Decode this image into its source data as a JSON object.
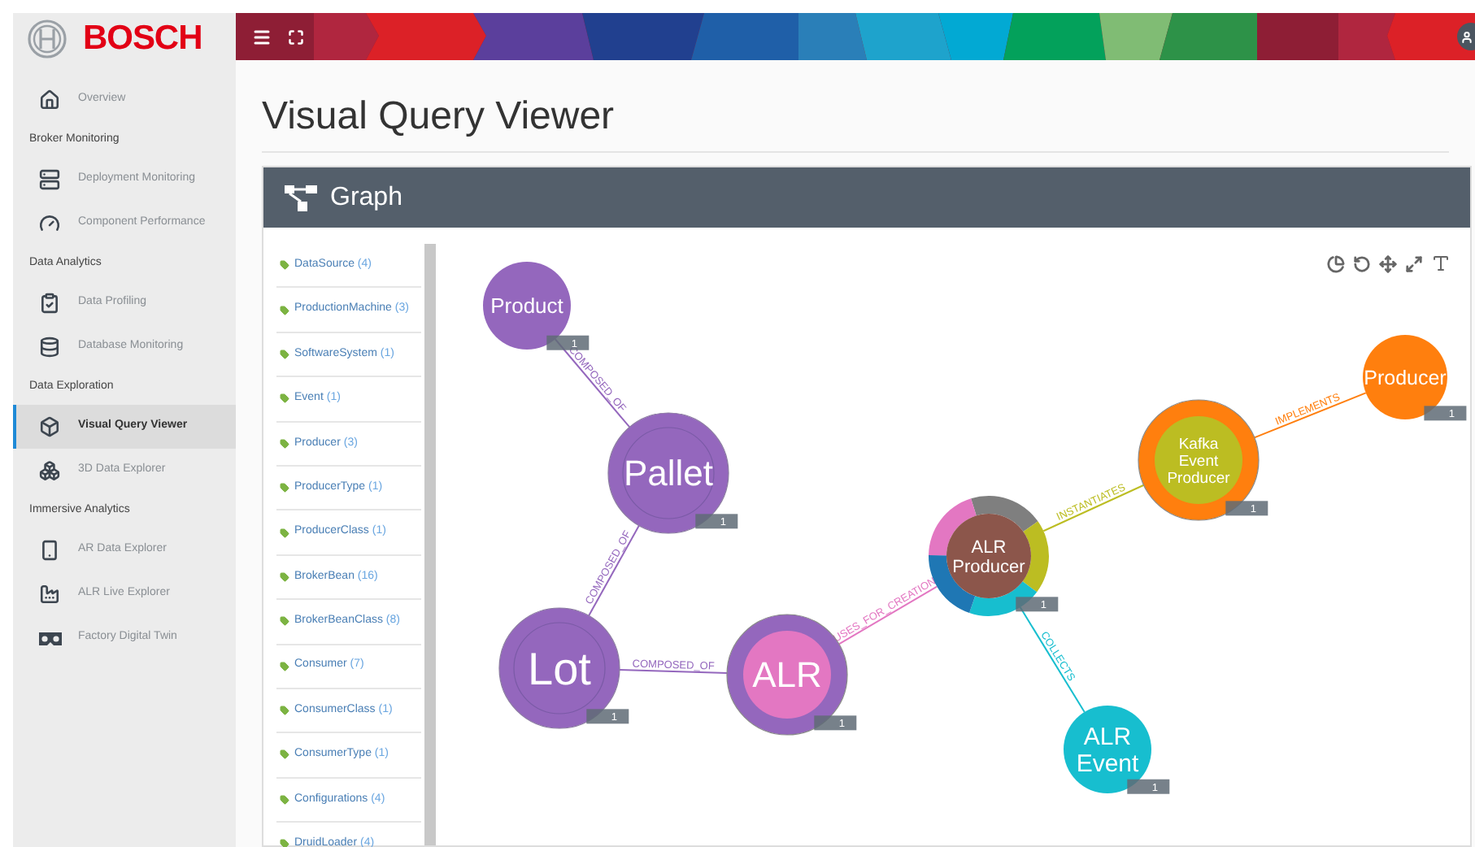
{
  "brand": {
    "name": "BOSCH"
  },
  "sidebar": {
    "items": [
      {
        "kind": "link",
        "label": "Overview",
        "selected": false
      },
      {
        "kind": "heading",
        "label": "Broker Monitoring"
      },
      {
        "kind": "link",
        "label": "Deployment Monitoring",
        "selected": false
      },
      {
        "kind": "link",
        "label": "Component Performance",
        "selected": false
      },
      {
        "kind": "heading",
        "label": "Data Analytics"
      },
      {
        "kind": "link",
        "label": "Data Profiling",
        "selected": false
      },
      {
        "kind": "link",
        "label": "Database Monitoring",
        "selected": false
      },
      {
        "kind": "heading",
        "label": "Data Exploration"
      },
      {
        "kind": "link",
        "label": "Visual Query Viewer",
        "selected": true
      },
      {
        "kind": "link",
        "label": "3D Data Explorer",
        "selected": false
      },
      {
        "kind": "heading",
        "label": "Immersive Analytics"
      },
      {
        "kind": "link",
        "label": "AR Data Explorer",
        "selected": false
      },
      {
        "kind": "link",
        "label": "ALR Live Explorer",
        "selected": false
      },
      {
        "kind": "link",
        "label": "Factory Digital Twin",
        "selected": false
      }
    ]
  },
  "page": {
    "title": "Visual Query Viewer"
  },
  "panel": {
    "title": "Graph"
  },
  "classes": [
    {
      "name": "DataSource",
      "count": "(4)"
    },
    {
      "name": "ProductionMachine",
      "count": "(3)"
    },
    {
      "name": "SoftwareSystem",
      "count": "(1)"
    },
    {
      "name": "Event",
      "count": "(1)"
    },
    {
      "name": "Producer",
      "count": "(3)"
    },
    {
      "name": "ProducerType",
      "count": "(1)"
    },
    {
      "name": "ProducerClass",
      "count": "(1)"
    },
    {
      "name": "BrokerBean",
      "count": "(16)"
    },
    {
      "name": "BrokerBeanClass",
      "count": "(8)"
    },
    {
      "name": "Consumer",
      "count": "(7)"
    },
    {
      "name": "ConsumerClass",
      "count": "(1)"
    },
    {
      "name": "ConsumerType",
      "count": "(1)"
    },
    {
      "name": "Configurations",
      "count": "(4)"
    },
    {
      "name": "DruidLoader",
      "count": "(4)"
    }
  ],
  "graph": {
    "nodes": [
      {
        "kind": "plain",
        "label": "Product",
        "color": "#9467bd",
        "count": "1"
      },
      {
        "kind": "ringed",
        "label": "Pallet",
        "color": "#9467bd",
        "count": "1"
      },
      {
        "kind": "ringed",
        "label": "Lot",
        "color": "#9467bd",
        "count": "1"
      },
      {
        "kind": "inner",
        "label": "ALR",
        "color": "#9467bd",
        "count": "1"
      },
      {
        "kind": "donut",
        "label": "ALR Producer",
        "color": "#8c564b",
        "count": "1"
      },
      {
        "kind": "inner",
        "label": "Kafka Event Producer",
        "color": "#ff7f0e",
        "count": "1"
      },
      {
        "kind": "plain",
        "label": "Producer",
        "color": "#ff7f0e",
        "count": "1"
      },
      {
        "kind": "plain",
        "label": "ALR Event",
        "color": "#17becf",
        "count": "1"
      }
    ],
    "edges": [
      {
        "label": "COMPOSED_OF",
        "color": "#9467bd"
      },
      {
        "label": "COMPOSED_OF",
        "color": "#9467bd"
      },
      {
        "label": "COMPOSED_OF",
        "color": "#9467bd"
      },
      {
        "label": "USES_FOR_CREATION",
        "color": "#e377c2"
      },
      {
        "label": "INSTANTIATES",
        "color": "#bcbd22"
      },
      {
        "label": "IMPLEMENTS",
        "color": "#ff7f0e"
      },
      {
        "label": "COLLECTS",
        "color": "#17becf"
      }
    ]
  }
}
